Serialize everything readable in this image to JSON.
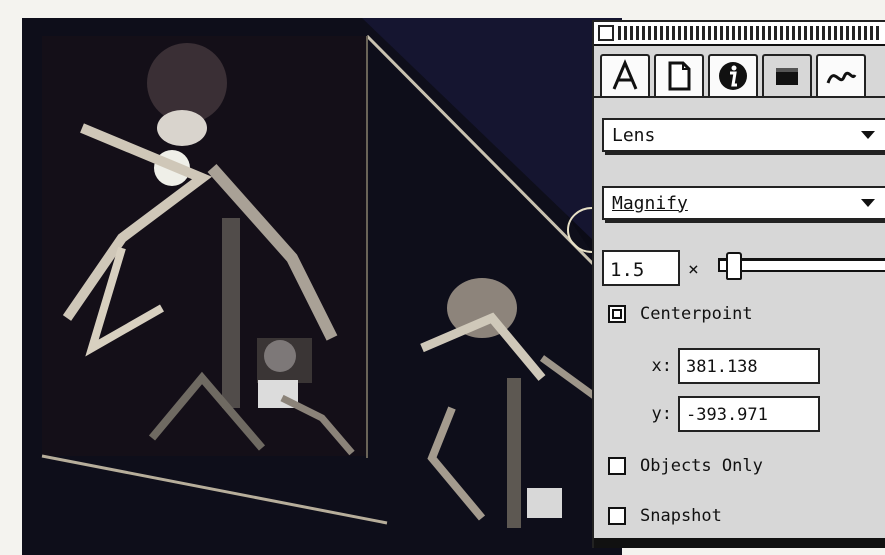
{
  "panel": {
    "tabs": [
      {
        "icon": "text-tool-icon",
        "active": false
      },
      {
        "icon": "page-icon",
        "active": false
      },
      {
        "icon": "info-icon",
        "active": false
      },
      {
        "icon": "window-icon",
        "active": true
      },
      {
        "icon": "curve-icon",
        "active": false
      }
    ],
    "effect_select": "Lens",
    "lens_type_select": "Magnify",
    "scale_value": "1.5",
    "scale_unit": "×",
    "slider_level": 0.05,
    "centerpoint": {
      "label": "Centerpoint",
      "checked": true
    },
    "x": {
      "label": "x:",
      "value": "381.138"
    },
    "y": {
      "label": "y:",
      "value": "-393.971"
    },
    "objects_only": {
      "label": "Objects Only",
      "checked": false
    },
    "snapshot": {
      "label": "Snapshot",
      "checked": false
    }
  },
  "colors": {
    "canvas_background": "#0c0c18",
    "panel_background": "#d7d7d7",
    "outline": "#222222"
  }
}
